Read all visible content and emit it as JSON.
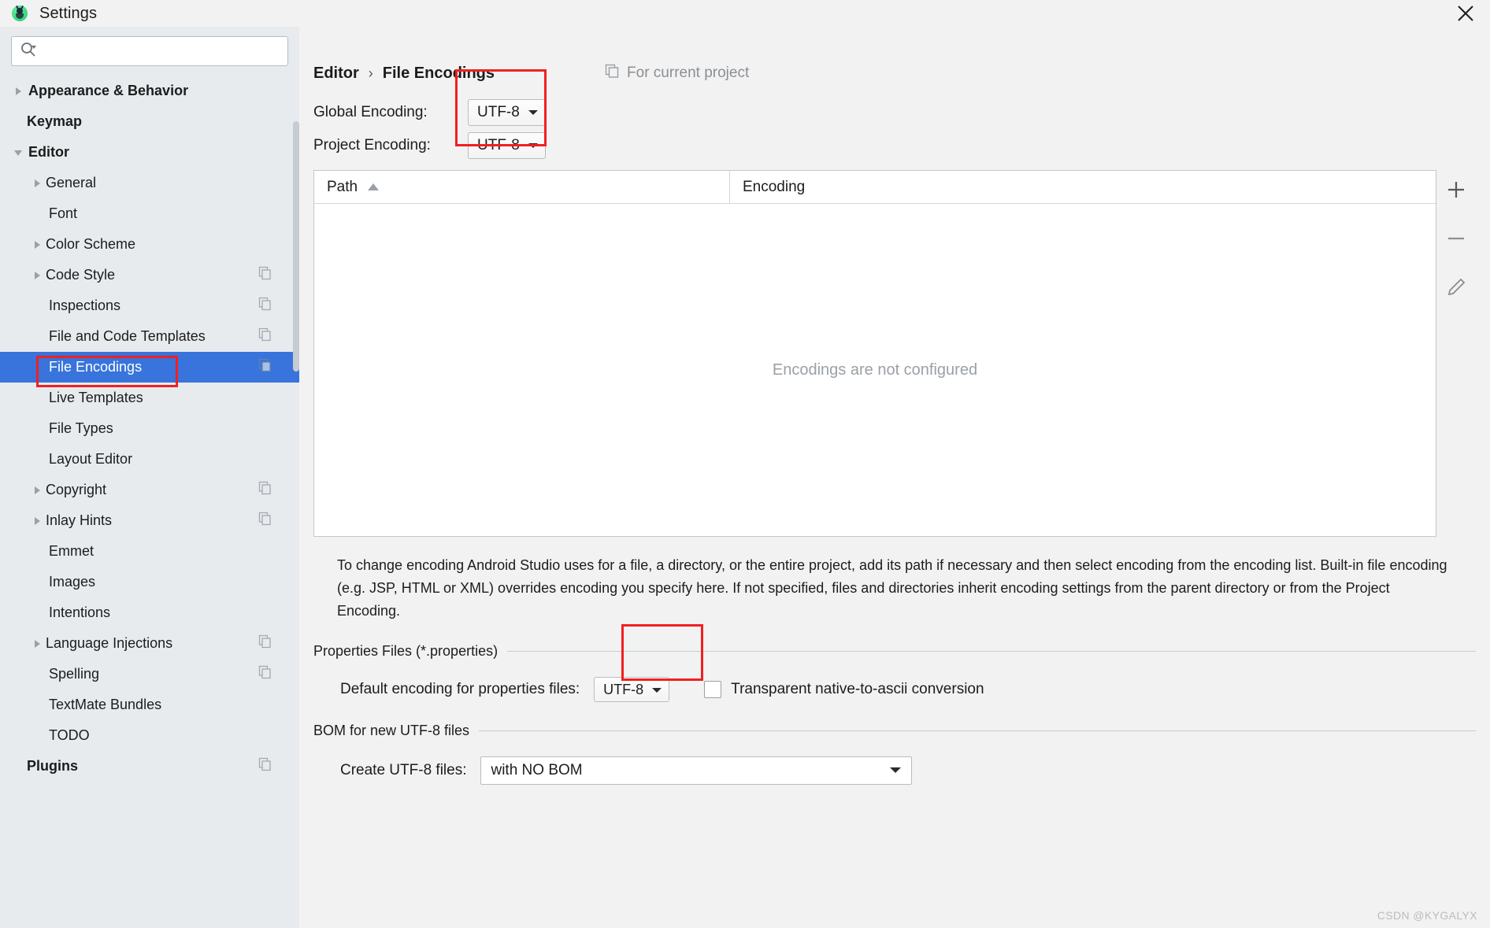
{
  "window": {
    "title": "Settings",
    "app_icon": "android-studio-icon",
    "close_label": "×"
  },
  "search": {
    "value": "",
    "placeholder": "",
    "icon": "search-icon"
  },
  "sidebar": {
    "items": [
      {
        "label": "Appearance & Behavior",
        "level": 0,
        "arrow": "collapsed",
        "bold": true,
        "badge": false,
        "selected": false
      },
      {
        "label": "Keymap",
        "level": 0,
        "arrow": "none",
        "bold": true,
        "badge": false,
        "selected": false
      },
      {
        "label": "Editor",
        "level": 0,
        "arrow": "expanded",
        "bold": true,
        "badge": false,
        "selected": false
      },
      {
        "label": "General",
        "level": 1,
        "arrow": "collapsed",
        "bold": false,
        "badge": false,
        "selected": false
      },
      {
        "label": "Font",
        "level": 1,
        "arrow": "none",
        "bold": false,
        "badge": false,
        "selected": false
      },
      {
        "label": "Color Scheme",
        "level": 1,
        "arrow": "collapsed",
        "bold": false,
        "badge": false,
        "selected": false
      },
      {
        "label": "Code Style",
        "level": 1,
        "arrow": "collapsed",
        "bold": false,
        "badge": true,
        "selected": false
      },
      {
        "label": "Inspections",
        "level": 1,
        "arrow": "none",
        "bold": false,
        "badge": true,
        "selected": false
      },
      {
        "label": "File and Code Templates",
        "level": 1,
        "arrow": "none",
        "bold": false,
        "badge": true,
        "selected": false
      },
      {
        "label": "File Encodings",
        "level": 1,
        "arrow": "none",
        "bold": false,
        "badge": true,
        "selected": true
      },
      {
        "label": "Live Templates",
        "level": 1,
        "arrow": "none",
        "bold": false,
        "badge": false,
        "selected": false
      },
      {
        "label": "File Types",
        "level": 1,
        "arrow": "none",
        "bold": false,
        "badge": false,
        "selected": false
      },
      {
        "label": "Layout Editor",
        "level": 1,
        "arrow": "none",
        "bold": false,
        "badge": false,
        "selected": false
      },
      {
        "label": "Copyright",
        "level": 1,
        "arrow": "collapsed",
        "bold": false,
        "badge": true,
        "selected": false
      },
      {
        "label": "Inlay Hints",
        "level": 1,
        "arrow": "collapsed",
        "bold": false,
        "badge": true,
        "selected": false
      },
      {
        "label": "Emmet",
        "level": 1,
        "arrow": "none",
        "bold": false,
        "badge": false,
        "selected": false
      },
      {
        "label": "Images",
        "level": 1,
        "arrow": "none",
        "bold": false,
        "badge": false,
        "selected": false
      },
      {
        "label": "Intentions",
        "level": 1,
        "arrow": "none",
        "bold": false,
        "badge": false,
        "selected": false
      },
      {
        "label": "Language Injections",
        "level": 1,
        "arrow": "collapsed",
        "bold": false,
        "badge": true,
        "selected": false
      },
      {
        "label": "Spelling",
        "level": 1,
        "arrow": "none",
        "bold": false,
        "badge": true,
        "selected": false
      },
      {
        "label": "TextMate Bundles",
        "level": 1,
        "arrow": "none",
        "bold": false,
        "badge": false,
        "selected": false
      },
      {
        "label": "TODO",
        "level": 1,
        "arrow": "none",
        "bold": false,
        "badge": false,
        "selected": false
      },
      {
        "label": "Plugins",
        "level": 0,
        "arrow": "none",
        "bold": true,
        "badge": true,
        "selected": false
      }
    ]
  },
  "main": {
    "breadcrumb": {
      "parent": "Editor",
      "separator": "›",
      "current": "File Encodings"
    },
    "for_current_project": {
      "label": "For current project",
      "icon": "copy-icon"
    },
    "global_encoding": {
      "label": "Global Encoding:",
      "value": "UTF-8"
    },
    "project_encoding": {
      "label": "Project Encoding:",
      "value": "UTF-8"
    },
    "table": {
      "columns": [
        "Path",
        "Encoding"
      ],
      "sort_column": "Path",
      "sort_direction": "ascending",
      "rows": [],
      "empty_text": "Encodings are not configured",
      "tools": [
        "add-icon",
        "remove-icon",
        "edit-icon"
      ]
    },
    "description": "To change encoding Android Studio uses for a file, a directory, or the entire project, add its path if necessary and then select encoding from the encoding list. Built-in file encoding (e.g. JSP, HTML or XML) overrides encoding you specify here. If not specified, files and directories inherit encoding settings from the parent directory or from the Project Encoding.",
    "properties_section": {
      "title": "Properties Files (*.properties)",
      "default_encoding_label": "Default encoding for properties files:",
      "default_encoding_value": "UTF-8",
      "transparent_label": "Transparent native-to-ascii conversion",
      "transparent_checked": false
    },
    "bom_section": {
      "title": "BOM for new UTF-8 files",
      "create_label": "Create UTF-8 files:",
      "create_value": "with NO BOM"
    }
  },
  "watermark": "CSDN @KYGALYX",
  "colors": {
    "selection_blue": "#3874db",
    "annotation_red": "#f02020",
    "sidebar_bg": "#e7ebee",
    "panel_bg": "#f2f2f2"
  }
}
